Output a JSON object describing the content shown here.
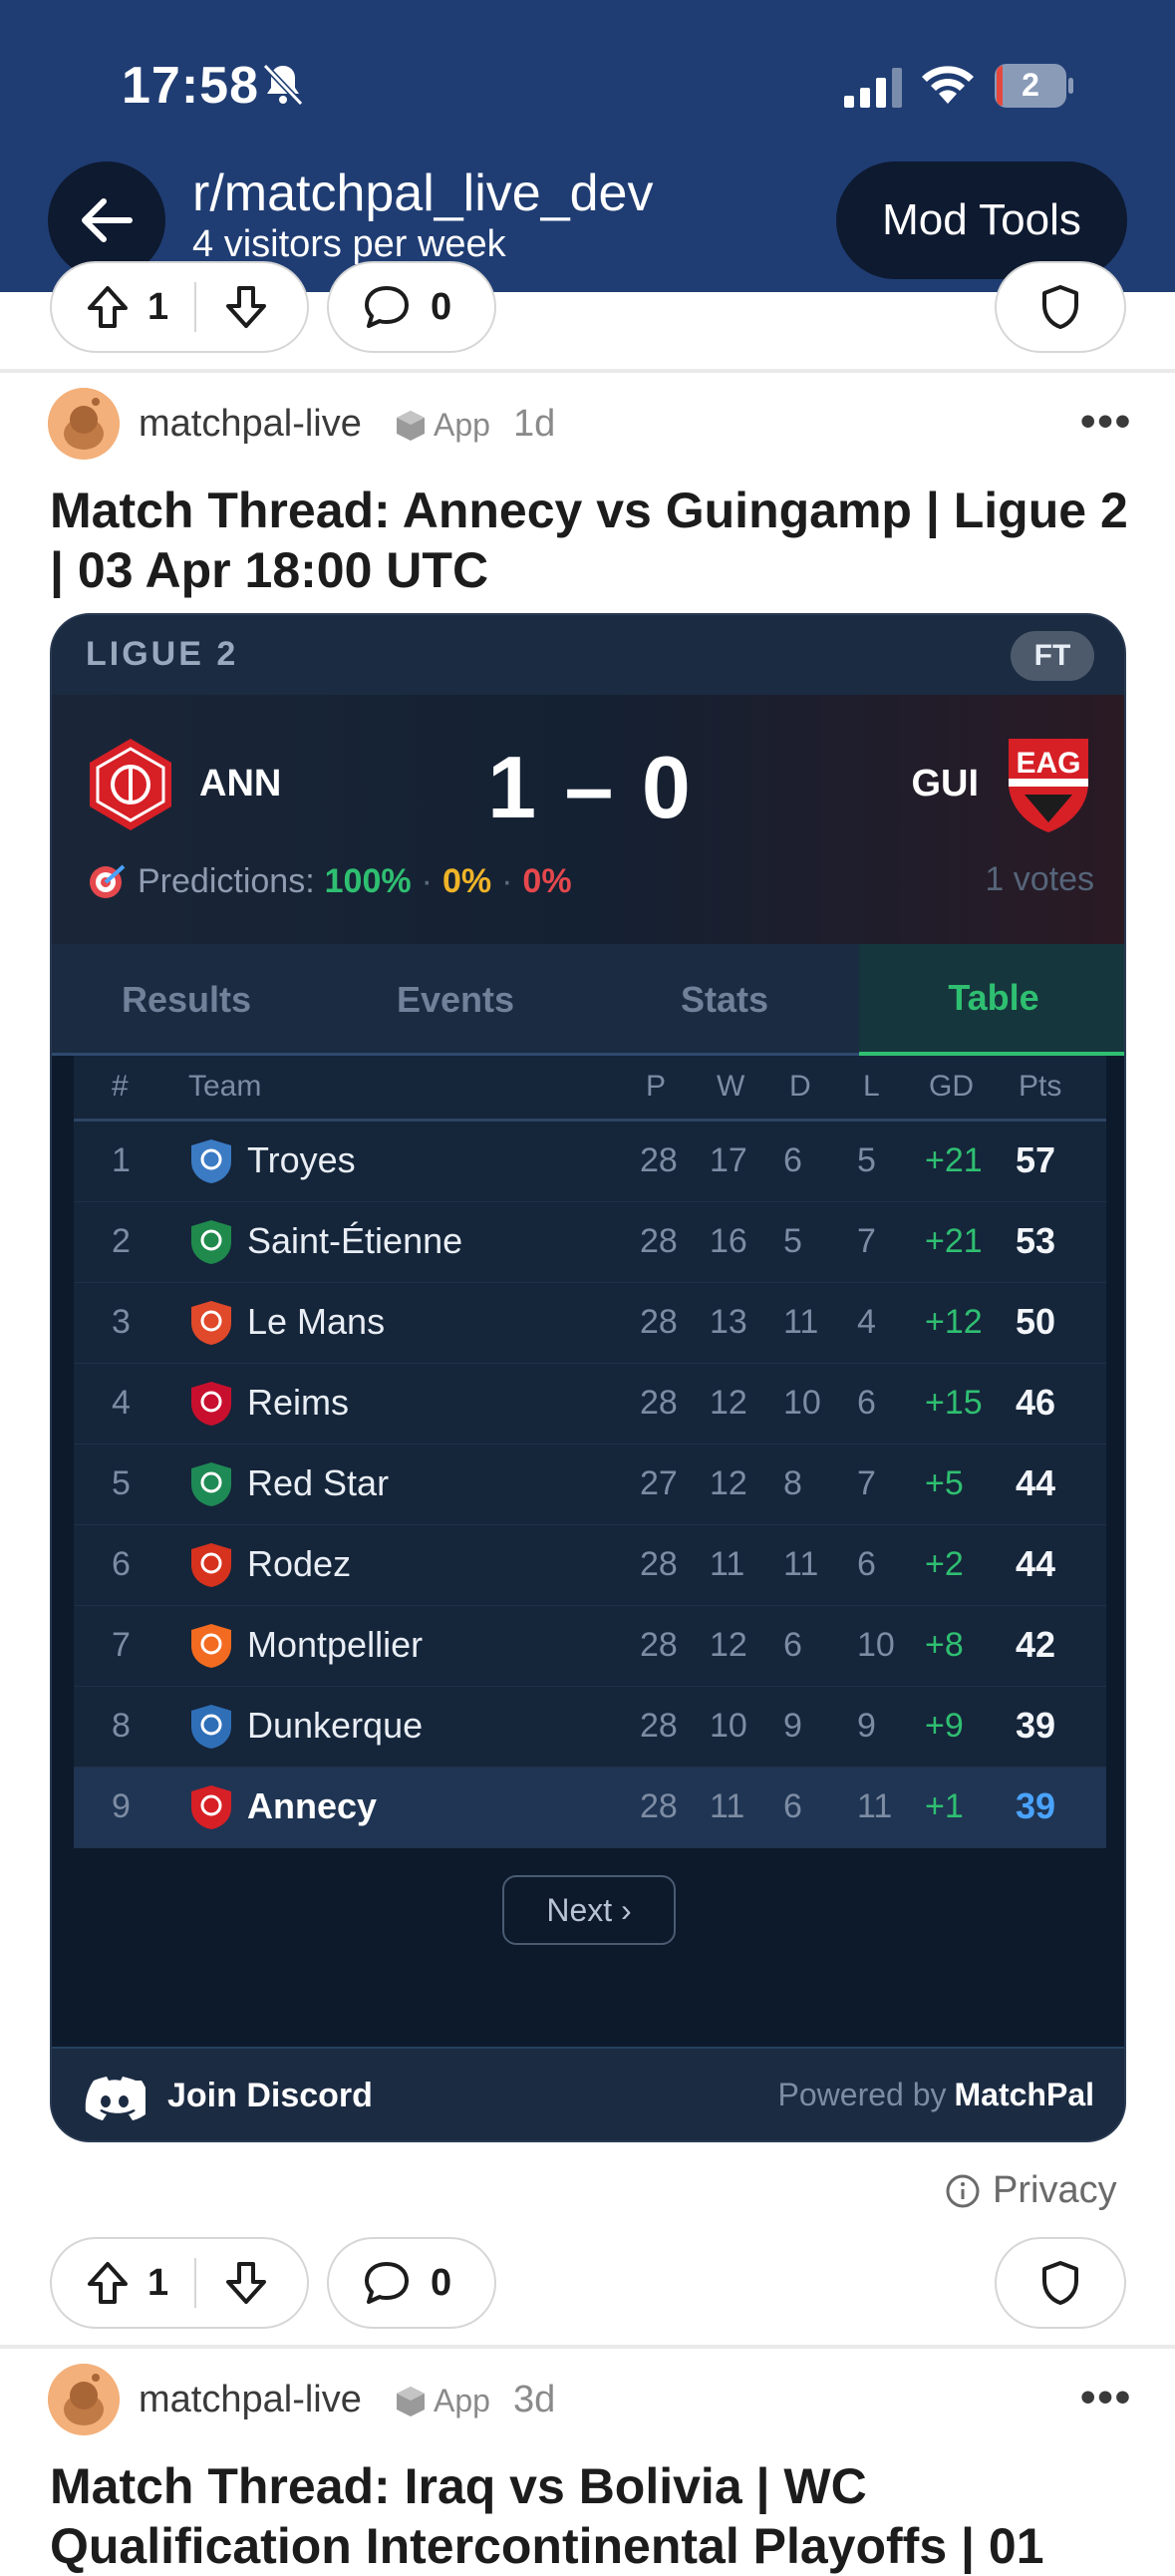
{
  "status_bar": {
    "time": "17:58",
    "battery": "2"
  },
  "header": {
    "subreddit": "r/matchpal_live_dev",
    "visitors": "4 visitors per week",
    "mod_tools": "Mod Tools"
  },
  "top_actions": {
    "upvotes": "1",
    "comments": "0"
  },
  "post": {
    "author": "matchpal-live",
    "badge": "App",
    "time": "1d",
    "title": "Match Thread: Annecy vs Guingamp | Ligue 2 | 03 Apr 18:00 UTC",
    "widget": {
      "league": "LIGUE 2",
      "status": "FT",
      "home": "ANN",
      "away": "GUI",
      "away_crest_text": "EAG",
      "score": "1 – 0",
      "predictions_label": "Predictions:",
      "pred_home": "100%",
      "pred_draw": "0%",
      "pred_away": "0%",
      "votes": "1 votes",
      "tabs": [
        "Results",
        "Events",
        "Stats",
        "Table"
      ],
      "active_tab": "Table",
      "table_headers": {
        "rank": "#",
        "team": "Team",
        "p": "P",
        "w": "W",
        "d": "D",
        "l": "L",
        "gd": "GD",
        "pts": "Pts"
      },
      "table": [
        {
          "rank": "1",
          "team": "Troyes",
          "p": "28",
          "w": "17",
          "d": "6",
          "l": "5",
          "gd": "+21",
          "pts": "57",
          "color": "#3b7bc4"
        },
        {
          "rank": "2",
          "team": "Saint-Étienne",
          "p": "28",
          "w": "16",
          "d": "5",
          "l": "7",
          "gd": "+21",
          "pts": "53",
          "color": "#1f8a4c"
        },
        {
          "rank": "3",
          "team": "Le Mans",
          "p": "28",
          "w": "13",
          "d": "11",
          "l": "4",
          "gd": "+12",
          "pts": "50",
          "color": "#e0492a"
        },
        {
          "rank": "4",
          "team": "Reims",
          "p": "28",
          "w": "12",
          "d": "10",
          "l": "6",
          "gd": "+15",
          "pts": "46",
          "color": "#c8102e"
        },
        {
          "rank": "5",
          "team": "Red Star",
          "p": "27",
          "w": "12",
          "d": "8",
          "l": "7",
          "gd": "+5",
          "pts": "44",
          "color": "#1e8a55"
        },
        {
          "rank": "6",
          "team": "Rodez",
          "p": "28",
          "w": "11",
          "d": "11",
          "l": "6",
          "gd": "+2",
          "pts": "44",
          "color": "#d6321e"
        },
        {
          "rank": "7",
          "team": "Montpellier",
          "p": "28",
          "w": "12",
          "d": "6",
          "l": "10",
          "gd": "+8",
          "pts": "42",
          "color": "#f26b21"
        },
        {
          "rank": "8",
          "team": "Dunkerque",
          "p": "28",
          "w": "10",
          "d": "9",
          "l": "9",
          "gd": "+9",
          "pts": "39",
          "color": "#2f6fb8"
        },
        {
          "rank": "9",
          "team": "Annecy",
          "p": "28",
          "w": "11",
          "d": "6",
          "l": "11",
          "gd": "+1",
          "pts": "39",
          "color": "#d71f26"
        }
      ],
      "next": "Next ›",
      "join_discord": "Join Discord",
      "powered_by": "Powered by",
      "brand": "MatchPal"
    },
    "privacy": "Privacy",
    "upvotes": "1",
    "comments": "0"
  },
  "next_post": {
    "author": "matchpal-live",
    "badge": "App",
    "time": "3d",
    "title": "Match Thread: Iraq vs Bolivia | WC Qualification Intercontinental Playoffs | 01"
  },
  "colors": {
    "header_bg": "#1f3d73",
    "widget_bg": "#0d1a2c",
    "accent_green": "#2fbf71"
  }
}
